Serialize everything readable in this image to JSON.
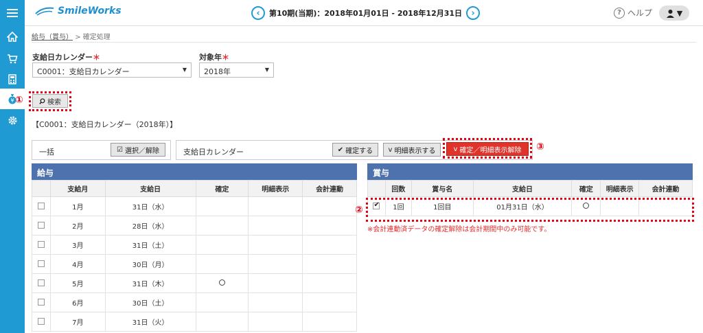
{
  "header": {
    "logo_text": "SmileWorks",
    "period": "第10期(当期)：2018年01月01日 - 2018年12月31日",
    "help_label": "ヘルプ"
  },
  "breadcrumb": {
    "link": "給与（賞与）",
    "separator": ">",
    "current": "確定処理"
  },
  "form": {
    "calendar_label": "支給日カレンダー",
    "calendar_value": "C0001：支給日カレンダー",
    "year_label": "対象年",
    "year_value": "2018年",
    "required_mark": "＊",
    "search_label": "検索"
  },
  "caption": "【C0001：支給日カレンダー（2018年）】",
  "toolbar": {
    "bulk_label": "一括",
    "select_toggle_label": "選択／解除",
    "calendar_label": "支給日カレンダー",
    "confirm_label": "確定する",
    "detail_show_label": "明細表示する",
    "unconfirm_label": "確定／明細表示解除"
  },
  "callouts": {
    "one": "①",
    "two": "②",
    "three": "③"
  },
  "salary": {
    "title": "給与",
    "columns": [
      "",
      "支給月",
      "支給日",
      "確定",
      "明細表示",
      "会計連動"
    ],
    "rows": [
      {
        "month": "1月",
        "day": "31日（水）",
        "confirmed": false
      },
      {
        "month": "2月",
        "day": "28日（水）",
        "confirmed": false
      },
      {
        "month": "3月",
        "day": "31日（土）",
        "confirmed": false
      },
      {
        "month": "4月",
        "day": "30日（月）",
        "confirmed": false
      },
      {
        "month": "5月",
        "day": "31日（木）",
        "confirmed": true
      },
      {
        "month": "6月",
        "day": "30日（土）",
        "confirmed": false
      },
      {
        "month": "7月",
        "day": "31日（火）",
        "confirmed": false
      }
    ]
  },
  "bonus": {
    "title": "賞与",
    "columns": [
      "",
      "回数",
      "賞与名",
      "支給日",
      "確定",
      "明細表示",
      "会計連動"
    ],
    "rows": [
      {
        "count": "1回",
        "name": "1回目",
        "day": "01月31日（水）",
        "checked": true,
        "confirmed": true
      }
    ],
    "note": "※会計連動済データの確定解除は会計期間中のみ可能です。"
  },
  "icons": {
    "menu": "hamburger-icon",
    "home": "home-icon",
    "cart": "cart-icon",
    "calculator": "calculator-icon",
    "money": "money-bag-icon",
    "settings": "gear-icon"
  }
}
